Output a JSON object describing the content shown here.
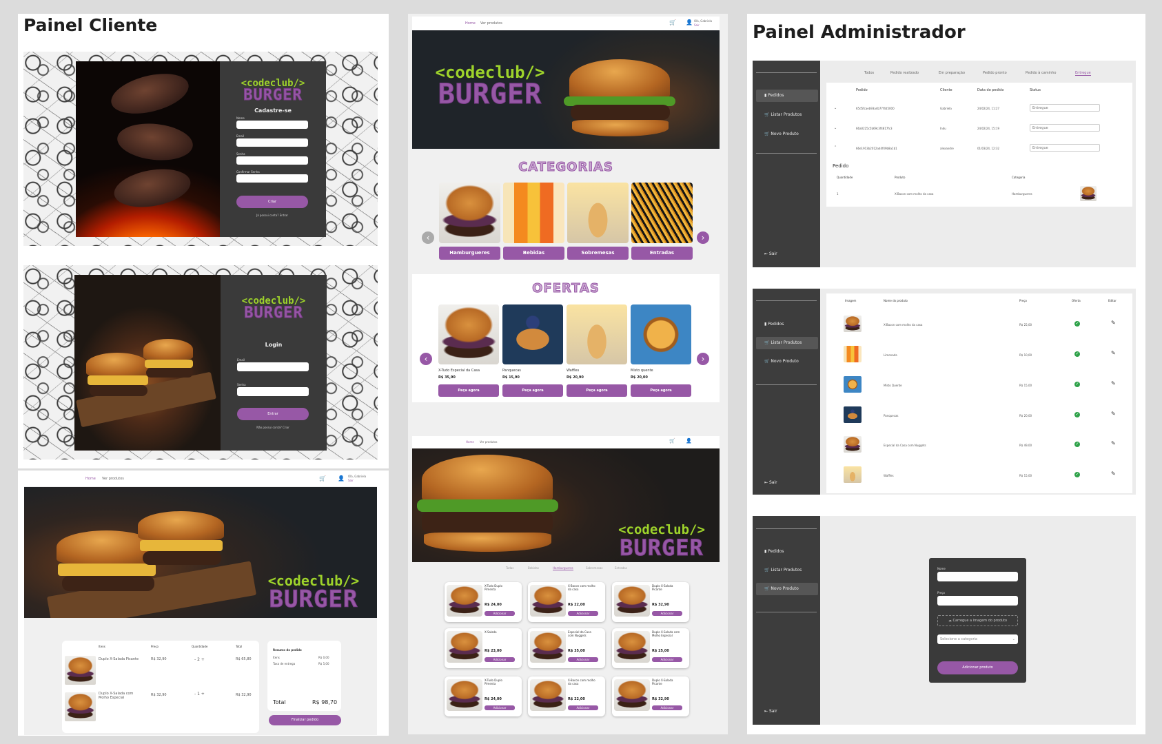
{
  "client_panel": {
    "title": "Painel Cliente",
    "register": {
      "logo_code": "<codeclub/>",
      "logo_burger": "BURGER",
      "heading": "Cadastre-se",
      "field_labels": [
        "Nome",
        "Email",
        "Senha",
        "Confirmar Senha"
      ],
      "submit": "Criar",
      "footer": "Já possui conta? Entrar"
    },
    "login": {
      "logo_code": "<codeclub/>",
      "logo_burger": "BURGER",
      "heading": "Login",
      "field_labels": [
        "Email",
        "Senha"
      ],
      "submit": "Entrar",
      "footer": "Não possui conta? Criar"
    },
    "cart": {
      "nav": [
        "Home",
        "Ver produtos"
      ],
      "greeting": "Olá, Gabriela",
      "logout": "Sair",
      "logo_code": "<codeclub/>",
      "logo_burger": "BURGER",
      "columns": [
        "Itens",
        "Preço",
        "Quantidade",
        "Total"
      ],
      "rows": [
        {
          "name": "Duplo X-Salada Picante",
          "price": "R$ 32,90",
          "qty": "- 2 +",
          "total": "R$ 65,80"
        },
        {
          "name": "Duplo X-Salada com Molho Especial",
          "price": "R$ 32,90",
          "qty": "- 1 +",
          "total": "R$ 32,90"
        }
      ],
      "summary_title": "Resumo do pedido",
      "summary_lines": [
        [
          "Itens",
          "R$ 0,00"
        ],
        [
          "Taxa de entrega",
          "R$ 5,00"
        ]
      ],
      "total_label": "Total",
      "total_value": "R$ 98,70",
      "finish": "Finalizar pedido"
    }
  },
  "home": {
    "nav": [
      "Home",
      "Ver produtos"
    ],
    "greeting": "Olá, Gabriela",
    "logout": "Sair",
    "logo_code": "<codeclub/>",
    "logo_burger": "BURGER",
    "categories_title": "CATEGORIAS",
    "categories": [
      "Hamburgueres",
      "Bebidas",
      "Sobremesas",
      "Entradas"
    ],
    "offers_title": "OFERTAS",
    "offers": [
      {
        "name": "X-Tudo Especial da Casa",
        "price": "R$ 35,90"
      },
      {
        "name": "Panquecas",
        "price": "R$ 15,90"
      },
      {
        "name": "Waffles",
        "price": "R$ 20,90"
      },
      {
        "name": "Misto quente",
        "price": "R$ 20,00"
      }
    ],
    "offer_button": "Peça agora"
  },
  "menu": {
    "nav": [
      "Home",
      "Ver produtos"
    ],
    "logo_code": "<codeclub/>",
    "logo_burger": "BURGER",
    "tabs": [
      "Todas",
      "Bebidas",
      "Hamburgueres",
      "Sobremesas",
      "Entradas"
    ],
    "products": [
      {
        "name": "X-Tudo Duplo Pimenta",
        "price": "R$ 24,00"
      },
      {
        "name": "X-Bacon com molho da casa",
        "price": "R$ 22,00"
      },
      {
        "name": "Duplo X-Salada Picante",
        "price": "R$ 32,90"
      },
      {
        "name": "X-Salada",
        "price": "R$ 23,00"
      },
      {
        "name": "Especial da Casa com Nuggets",
        "price": "R$ 35,00"
      },
      {
        "name": "Duplo X-Salada com Molho Especial",
        "price": "R$ 25,00"
      },
      {
        "name": "X-Tudo Duplo Pimenta",
        "price": "R$ 24,00"
      },
      {
        "name": "X-Bacon com molho da casa",
        "price": "R$ 22,00"
      },
      {
        "name": "Duplo X-Salada Picante",
        "price": "R$ 32,90"
      }
    ],
    "add_button": "Adicionar"
  },
  "admin_panel": {
    "title": "Painel Administrador",
    "sidebar": [
      "Pedidos",
      "Listar Produtos",
      "Novo Produto"
    ],
    "logout": "Sair",
    "orders": {
      "filters": [
        "Todos",
        "Pedido realizado",
        "Em preparação",
        "Pedido pronto",
        "Pedido à caminho",
        "Entregue"
      ],
      "columns": [
        "Pedido",
        "Cliente",
        "Data do pedido",
        "Status"
      ],
      "rows": [
        {
          "id": "65d5fcaeb93a4b77f4d5000",
          "client": "Gabriela",
          "date": "24/02/24, 11:27",
          "status": "Entregue"
        },
        {
          "id": "66a0225c5b69c3f4817fc3",
          "client": "Indu",
          "date": "24/02/24, 15:19",
          "status": "Entregue"
        },
        {
          "id": "66e1913b2012ad4f49b8a1b1",
          "client": "alexandre",
          "date": "01/03/24, 12:32",
          "status": "Entregue"
        }
      ],
      "detail_title": "Pedido",
      "detail_columns": [
        "Quantidade",
        "Produto",
        "Categoria"
      ],
      "detail_row": {
        "qty": "1",
        "product": "X-Bacon com molho da casa",
        "category": "Hamburgueres"
      }
    },
    "products": {
      "columns": [
        "Imagem",
        "Nome do produto",
        "Preço",
        "Oferta",
        "Editar"
      ],
      "rows": [
        {
          "name": "X-Bacon com molho da casa",
          "price": "R$ 25,00"
        },
        {
          "name": "Limonada",
          "price": "R$ 10,00"
        },
        {
          "name": "Misto Quente",
          "price": "R$ 15,00"
        },
        {
          "name": "Panquecas",
          "price": "R$ 20,00"
        },
        {
          "name": "Especial da Casa com Nuggets",
          "price": "R$ 49,00"
        },
        {
          "name": "Waffles",
          "price": "R$ 15,00"
        }
      ]
    },
    "new_product": {
      "labels": [
        "Nome",
        "Preço"
      ],
      "upload": "Carregue a imagem do produto",
      "category_placeholder": "Selecione a categoria",
      "submit": "Adicionar produto"
    }
  },
  "colors": {
    "accent": "#9758a6",
    "lime": "#9ed32b",
    "sidebar": "#3d3d3d"
  }
}
